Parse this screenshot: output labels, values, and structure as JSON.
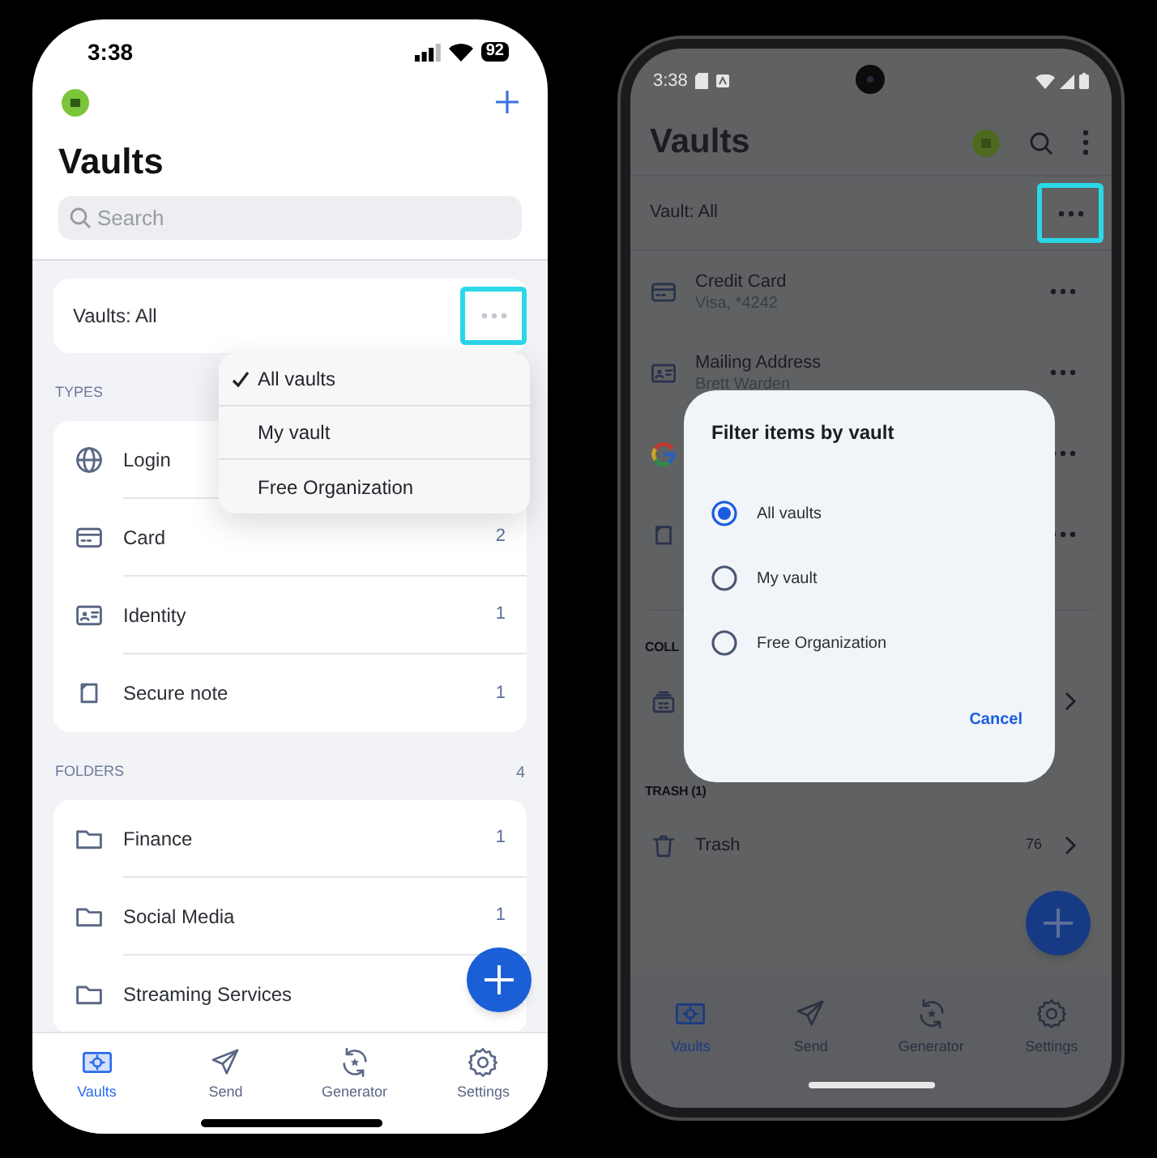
{
  "ios": {
    "status_bar": {
      "time": "3:38",
      "battery": "92"
    },
    "title": "Vaults",
    "search": {
      "placeholder": "Search"
    },
    "vault_filter": {
      "label": "Vaults: All"
    },
    "vault_menu": [
      {
        "label": "All vaults",
        "selected": true
      },
      {
        "label": "My vault",
        "selected": false
      },
      {
        "label": "Free Organization",
        "selected": false
      }
    ],
    "types": {
      "heading": "TYPES",
      "items": [
        {
          "kind": "globe",
          "label": "Login"
        },
        {
          "kind": "card",
          "label": "Card",
          "count": "2"
        },
        {
          "kind": "identity",
          "label": "Identity",
          "count": "1"
        },
        {
          "kind": "note",
          "label": "Secure note",
          "count": "1"
        }
      ]
    },
    "folders": {
      "heading": "FOLDERS",
      "count": "4",
      "items": [
        {
          "kind": "folder",
          "label": "Finance",
          "count": "1"
        },
        {
          "kind": "folder",
          "label": "Social Media",
          "count": "1"
        },
        {
          "kind": "folder",
          "label": "Streaming Services"
        }
      ]
    },
    "tabs": [
      {
        "kind": "vaults",
        "label": "Vaults",
        "selected": true
      },
      {
        "kind": "send",
        "label": "Send",
        "selected": false
      },
      {
        "kind": "generator",
        "label": "Generator",
        "selected": false
      },
      {
        "kind": "settings",
        "label": "Settings",
        "selected": false
      }
    ]
  },
  "android": {
    "status_bar": {
      "time": "3:38"
    },
    "title": "Vaults",
    "vault_filter": {
      "label": "Vault: All"
    },
    "items": [
      {
        "kind": "card",
        "title": "Credit Card",
        "subtitle": "Visa, *4242"
      },
      {
        "kind": "identity",
        "title": "Mailing Address",
        "subtitle": "Brett Warden"
      },
      {
        "kind": "login"
      },
      {
        "kind": "note"
      }
    ],
    "collections": {
      "heading": "COLL",
      "items": [
        {
          "kind": "collection"
        }
      ]
    },
    "trash": {
      "heading": "TRASH (1)",
      "items": [
        {
          "kind": "trash",
          "label": "Trash",
          "count": "76"
        }
      ]
    },
    "tabs": [
      {
        "kind": "vaults",
        "label": "Vaults",
        "selected": true
      },
      {
        "kind": "send",
        "label": "Send",
        "selected": false
      },
      {
        "kind": "generator",
        "label": "Generator",
        "selected": false
      },
      {
        "kind": "settings",
        "label": "Settings",
        "selected": false
      }
    ],
    "dialog": {
      "title": "Filter items by vault",
      "options": [
        {
          "label": "All vaults",
          "selected": true
        },
        {
          "label": "My vault",
          "selected": false
        },
        {
          "label": "Free Organization",
          "selected": false
        }
      ],
      "cancel": "Cancel"
    }
  }
}
